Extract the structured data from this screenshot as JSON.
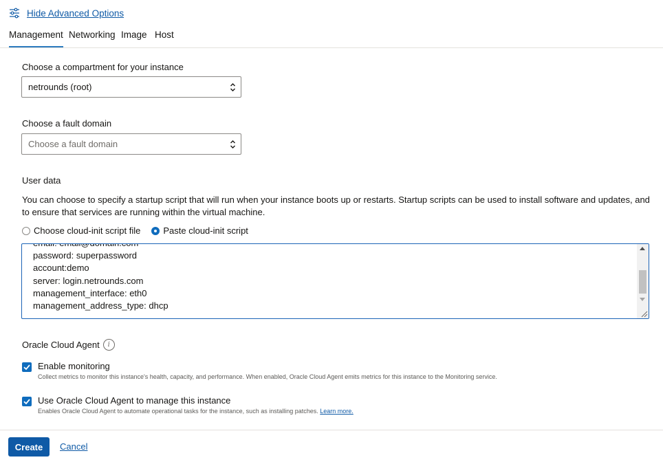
{
  "advanced": {
    "toggle_label": "Hide Advanced Options",
    "icon": "sliders-icon"
  },
  "tabs": [
    {
      "label": "Management",
      "active": true
    },
    {
      "label": "Networking",
      "active": false
    },
    {
      "label": "Image",
      "active": false
    },
    {
      "label": "Host",
      "active": false
    }
  ],
  "compartment": {
    "label": "Choose a compartment for your instance",
    "value": "netrounds (root)"
  },
  "fault_domain": {
    "label": "Choose a fault domain",
    "placeholder": "Choose a fault domain"
  },
  "user_data": {
    "label": "User data",
    "description": "You can choose to specify a startup script that will run when your instance boots up or restarts. Startup scripts can be used to install software and updates, and to ensure that services are running within the virtual machine.",
    "options": [
      {
        "label": "Choose cloud-init script file",
        "selected": false
      },
      {
        "label": "Paste cloud-init script",
        "selected": true
      }
    ],
    "script_lines": [
      "email: email@domain.com",
      "password: superpassword",
      "account:demo",
      "server: login.netrounds.com",
      "management_interface: eth0",
      "management_address_type: dhcp"
    ]
  },
  "agent": {
    "title": "Oracle Cloud Agent",
    "info_icon": "info-icon",
    "options": [
      {
        "label": "Enable monitoring",
        "checked": true,
        "description": "Collect metrics to monitor this instance's health, capacity, and performance. When enabled, Oracle Cloud Agent emits metrics for this instance to the Monitoring service."
      },
      {
        "label": "Use Oracle Cloud Agent to manage this instance",
        "checked": true,
        "description": "Enables Oracle Cloud Agent to automate operational tasks for the instance, such as installing patches.",
        "link": "Learn more."
      }
    ]
  },
  "footer": {
    "create_label": "Create",
    "cancel_label": "Cancel"
  },
  "colors": {
    "primary": "#0f5aa6",
    "accent": "#0f6cbd",
    "link": "#0f5aa6",
    "border": "#8b8986"
  }
}
